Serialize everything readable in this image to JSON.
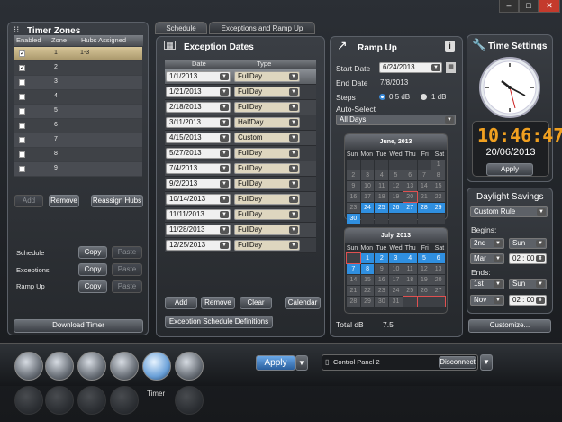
{
  "window": {
    "min": "–",
    "max": "□",
    "close": "✕"
  },
  "timer_zones": {
    "title": "Timer Zones",
    "cols": [
      "Enabled",
      "Zone",
      "Hubs Assigned"
    ],
    "rows": [
      {
        "en": "✓",
        "zone": "1",
        "hubs": "1-3"
      },
      {
        "en": "✓",
        "zone": "2",
        "hubs": ""
      },
      {
        "en": "",
        "zone": "3",
        "hubs": ""
      },
      {
        "en": "",
        "zone": "4",
        "hubs": ""
      },
      {
        "en": "",
        "zone": "5",
        "hubs": ""
      },
      {
        "en": "",
        "zone": "6",
        "hubs": ""
      },
      {
        "en": "",
        "zone": "7",
        "hubs": ""
      },
      {
        "en": "",
        "zone": "8",
        "hubs": ""
      },
      {
        "en": "",
        "zone": "9",
        "hubs": ""
      }
    ],
    "add": "Add",
    "remove": "Remove",
    "reassign": "Reassign Hubs",
    "copy_rows": [
      {
        "label": "Schedule",
        "copy": "Copy",
        "paste": "Paste"
      },
      {
        "label": "Exceptions",
        "copy": "Copy",
        "paste": "Paste"
      },
      {
        "label": "Ramp Up",
        "copy": "Copy",
        "paste": "Paste"
      }
    ],
    "download": "Download Timer"
  },
  "tabs": {
    "schedule": "Schedule",
    "exceptions": "Exceptions and Ramp Up"
  },
  "exceptions": {
    "title": "Exception Dates",
    "cols": [
      "Date",
      "Type"
    ],
    "rows": [
      {
        "date": "1/1/2013",
        "type": "FullDay"
      },
      {
        "date": "1/21/2013",
        "type": "FullDay"
      },
      {
        "date": "2/18/2013",
        "type": "FullDay"
      },
      {
        "date": "3/11/2013",
        "type": "HalfDay"
      },
      {
        "date": "4/15/2013",
        "type": "Custom"
      },
      {
        "date": "5/27/2013",
        "type": "FullDay"
      },
      {
        "date": "7/4/2013",
        "type": "FullDay"
      },
      {
        "date": "9/2/2013",
        "type": "FullDay"
      },
      {
        "date": "10/14/2013",
        "type": "FullDay"
      },
      {
        "date": "11/11/2013",
        "type": "FullDay"
      },
      {
        "date": "11/28/2013",
        "type": "FullDay"
      },
      {
        "date": "12/25/2013",
        "type": "FullDay"
      }
    ],
    "add": "Add",
    "remove": "Remove",
    "clear": "Clear",
    "calendar": "Calendar",
    "defs": "Exception Schedule Definitions"
  },
  "ramp_up": {
    "title": "Ramp Up",
    "info": "i",
    "start_label": "Start Date",
    "start_value": "6/24/2013",
    "end_label": "End Date",
    "end_value": "7/8/2013",
    "steps_label": "Steps",
    "step1": "0.5 dB",
    "step2": "1 dB",
    "auto_label": "Auto-Select",
    "auto_value": "All Days",
    "june": {
      "title": "June, 2013",
      "dow": [
        "Sun",
        "Mon",
        "Tue",
        "Wed",
        "Thu",
        "Fri",
        "Sat"
      ],
      "cells": [
        "",
        "",
        "",
        "",
        "",
        "",
        "1",
        "2",
        "3",
        "4",
        "5",
        "6",
        "7",
        "8",
        "9",
        "10",
        "11",
        "12",
        "13",
        "14",
        "15",
        "16",
        "17",
        "18",
        "19",
        "20",
        "21",
        "22",
        "23",
        "24",
        "25",
        "26",
        "27",
        "28",
        "29",
        "30",
        "",
        "",
        "",
        "",
        "",
        ""
      ]
    },
    "july": {
      "title": "July, 2013",
      "dow": [
        "Sun",
        "Mon",
        "Tue",
        "Wed",
        "Thu",
        "Fri",
        "Sat"
      ],
      "cells": [
        "",
        "1",
        "2",
        "3",
        "4",
        "5",
        "6",
        "7",
        "8",
        "9",
        "10",
        "11",
        "12",
        "13",
        "14",
        "15",
        "16",
        "17",
        "18",
        "19",
        "20",
        "21",
        "22",
        "23",
        "24",
        "25",
        "26",
        "27",
        "28",
        "29",
        "30",
        "31",
        "",
        "",
        ""
      ]
    },
    "total_label": "Total dB",
    "total_value": "7.5"
  },
  "time_settings": {
    "title": "Time Settings",
    "time": "10:46:47",
    "date": "20/06/2013",
    "apply": "Apply",
    "ds_title": "Daylight Savings",
    "rule": "Custom Rule",
    "begins": "Begins:",
    "b_week": "2nd",
    "b_day": "Sun",
    "b_month": "Mar",
    "b_time": "02 : 00",
    "ends": "Ends:",
    "e_week": "1st",
    "e_day": "Sun",
    "e_month": "Nov",
    "e_time": "02 : 00",
    "customize": "Customize..."
  },
  "bottom": {
    "apply": "Apply",
    "panel": "Control Panel 2",
    "disconnect": "Disconnect",
    "timer_label": "Timer"
  }
}
